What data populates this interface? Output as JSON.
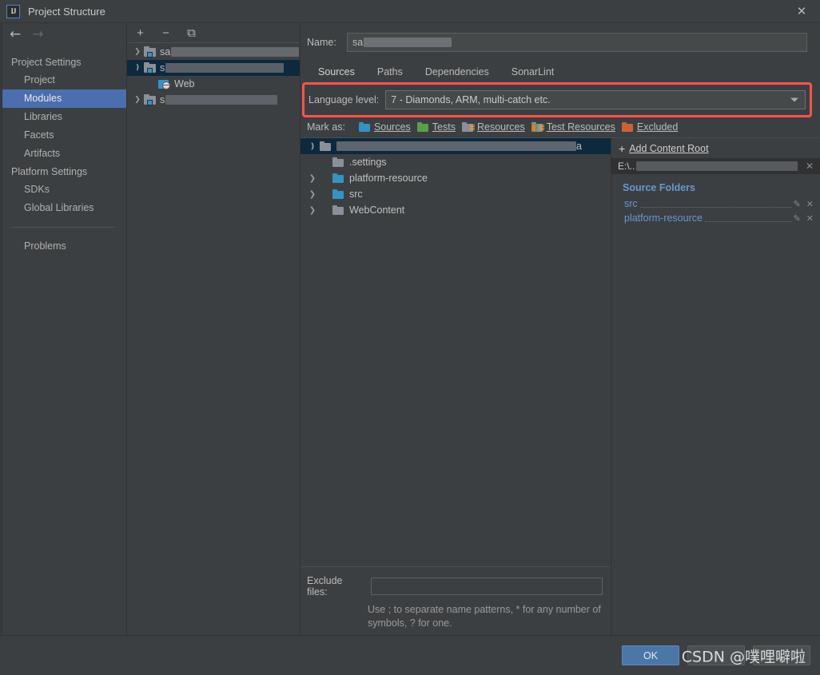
{
  "window": {
    "title": "Project Structure",
    "app_icon": "intellij-idea-icon",
    "close_label": "✕"
  },
  "sidebar": {
    "nav": {
      "back": "←",
      "forward": "→"
    },
    "groups": [
      {
        "label": "Project Settings",
        "items": [
          {
            "label": "Project",
            "selected": false
          },
          {
            "label": "Modules",
            "selected": true
          },
          {
            "label": "Libraries",
            "selected": false
          },
          {
            "label": "Facets",
            "selected": false
          },
          {
            "label": "Artifacts",
            "selected": false
          }
        ]
      },
      {
        "label": "Platform Settings",
        "items": [
          {
            "label": "SDKs",
            "selected": false
          },
          {
            "label": "Global Libraries",
            "selected": false
          }
        ]
      }
    ],
    "footer_item": {
      "label": "Problems"
    }
  },
  "modules_panel": {
    "toolbar": {
      "add": "+",
      "remove": "−",
      "copy": "⧉"
    },
    "tree": [
      {
        "label": "sa",
        "redacted": true,
        "redact_width": 160,
        "expanded": false,
        "selected": false,
        "icon": "module-folder-icon",
        "depth": 0
      },
      {
        "label": "s",
        "redacted": true,
        "redact_width": 148,
        "expanded": true,
        "selected": true,
        "icon": "module-folder-icon",
        "depth": 0
      },
      {
        "label": "Web",
        "redacted": false,
        "expanded": null,
        "selected": false,
        "icon": "web-facet-icon",
        "depth": 1
      },
      {
        "label": "s",
        "redacted": true,
        "redact_width": 140,
        "expanded": false,
        "selected": false,
        "icon": "module-folder-icon",
        "depth": 0
      }
    ]
  },
  "detail": {
    "name_label": "Name:",
    "name_value": "sa",
    "name_redacted": true,
    "tabs": [
      {
        "label": "Sources",
        "active": true
      },
      {
        "label": "Paths",
        "active": false
      },
      {
        "label": "Dependencies",
        "active": false
      },
      {
        "label": "SonarLint",
        "active": false
      }
    ],
    "language_level": {
      "label": "Language level:",
      "value": "7 - Diamonds, ARM, multi-catch etc.",
      "highlighted": true,
      "highlight_color": "#fb5449"
    },
    "mark_as": {
      "label": "Mark as:",
      "options": [
        {
          "label": "Sources",
          "mnemonic": "S",
          "color": "#3592c4",
          "style": "plain"
        },
        {
          "label": "Tests",
          "mnemonic": "T",
          "color": "#5a9e49",
          "style": "plain"
        },
        {
          "label": "Resources",
          "mnemonic": "R",
          "color": "#8a9099",
          "style": "lines"
        },
        {
          "label": "Test Resources",
          "mnemonic": "T",
          "color": "#8a9099",
          "style": "test-resources"
        },
        {
          "label": "Excluded",
          "mnemonic": "E",
          "color": "#cc6136",
          "style": "plain"
        }
      ]
    },
    "content_tree": [
      {
        "label": "a",
        "redacted": true,
        "redact_width": 300,
        "expanded": true,
        "selected": true,
        "depth": 0,
        "color": "#8a9099",
        "has_toggle": true
      },
      {
        "label": ".settings",
        "redacted": false,
        "expanded": null,
        "selected": false,
        "depth": 1,
        "color": "#8a9099",
        "has_toggle": false
      },
      {
        "label": "platform-resource",
        "redacted": false,
        "expanded": false,
        "selected": false,
        "depth": 1,
        "color": "#3592c4",
        "has_toggle": true
      },
      {
        "label": "src",
        "redacted": false,
        "expanded": false,
        "selected": false,
        "depth": 1,
        "color": "#3592c4",
        "has_toggle": true
      },
      {
        "label": "WebContent",
        "redacted": false,
        "expanded": false,
        "selected": false,
        "depth": 1,
        "color": "#8a9099",
        "has_toggle": true
      }
    ],
    "exclude": {
      "label": "Exclude files:",
      "value": "",
      "hint": "Use ; to separate name patterns, * for any number of symbols, ? for one."
    }
  },
  "right_panel": {
    "add_content_root": "Add Content Root",
    "add_content_root_mnemonic": "C",
    "content_root": {
      "path_prefix": "E:\\..",
      "redacted": true,
      "remove": "✕"
    },
    "source_folders_title": "Source Folders",
    "source_folders": [
      {
        "name": "src",
        "edit": "✎",
        "remove": "✕"
      },
      {
        "name": "platform-resource",
        "edit": "✎",
        "remove": "✕"
      }
    ]
  },
  "footer": {
    "buttons": [
      {
        "label": "OK",
        "kind": "primary"
      },
      {
        "label": "",
        "kind": "normal"
      },
      {
        "label": "",
        "kind": "normal"
      }
    ],
    "watermark": "CSDN @噗哩噼啦"
  }
}
